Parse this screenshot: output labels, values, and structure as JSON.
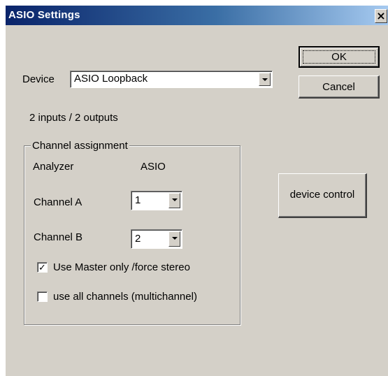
{
  "window": {
    "title": "ASIO Settings",
    "close_glyph": "×"
  },
  "buttons": {
    "ok": "OK",
    "cancel": "Cancel",
    "device_control": "device control"
  },
  "device": {
    "label": "Device",
    "selected": "ASIO Loopback",
    "io_info": "2 inputs / 2 outputs"
  },
  "channel_assignment": {
    "legend": "Channel assignment",
    "col_analyzer": "Analyzer",
    "col_asio": "ASIO",
    "channel_a": {
      "label": "Channel A",
      "value": "1"
    },
    "channel_b": {
      "label": "Channel B",
      "value": "2"
    },
    "use_master": {
      "label": "Use Master only /force stereo",
      "checked": true,
      "mark": "✓"
    },
    "use_all": {
      "label": "use all channels (multichannel)",
      "checked": false,
      "mark": ""
    }
  }
}
